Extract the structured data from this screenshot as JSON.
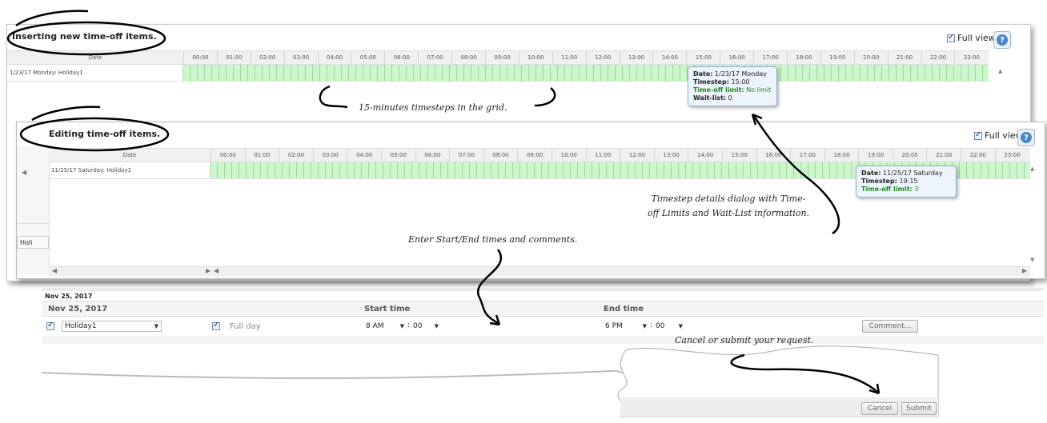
{
  "insert_panel": {
    "title": "Inserting new time-off items.",
    "full_view_label": "Full view",
    "date_header": "Date",
    "hours": [
      "00:00",
      "01:00",
      "02:00",
      "03:00",
      "04:00",
      "05:00",
      "06:00",
      "07:00",
      "08:00",
      "09:00",
      "10:00",
      "11:00",
      "12:00",
      "13:00",
      "14:00",
      "15:00",
      "16:00",
      "17:00",
      "18:00",
      "19:00",
      "20:00",
      "21:00",
      "22:00",
      "23:00"
    ],
    "row_label": "1/23/17 Monday: Holiday1",
    "tooltip": {
      "date_label": "Date:",
      "date_value": "1/23/17 Monday",
      "timestep_label": "Timestep:",
      "timestep_value": "15:00",
      "limit_label": "Time-off limit:",
      "limit_value": "No limit",
      "waitlist_label": "Wait-list:",
      "waitlist_value": "0"
    }
  },
  "edit_panel": {
    "title": "Editing time-off items.",
    "full_view_label": "Full view",
    "date_header": "Date",
    "hours": [
      "00:00",
      "01:00",
      "02:00",
      "03:00",
      "04:00",
      "05:00",
      "06:00",
      "07:00",
      "08:00",
      "09:00",
      "10:00",
      "11:00",
      "12:00",
      "13:00",
      "14:00",
      "15:00",
      "16:00",
      "17:00",
      "18:00",
      "19:00",
      "20:00",
      "21:00",
      "22:00",
      "23:00"
    ],
    "row_label": "11/25/17 Saturday: Holiday1",
    "tooltip": {
      "date_label": "Date:",
      "date_value": "11/25/17 Saturday",
      "timestep_label": "Timestep:",
      "timestep_value": "19:15",
      "limit_label": "Time-off limit:",
      "limit_value": "3"
    },
    "side_tab": "Holi"
  },
  "form": {
    "section_title": "Nov 25, 2017",
    "date_header": "Nov 25, 2017",
    "start_header": "Start time",
    "end_header": "End time",
    "type_value": "Holiday1",
    "full_day_label": "Full day",
    "start_hour": "8 AM",
    "start_min": "00",
    "end_hour": "6 PM",
    "end_min": "00",
    "time_sep": ":",
    "comment_button": "Comment..."
  },
  "buttons": {
    "cancel": "Cancel",
    "submit": "Submit"
  },
  "annotations": {
    "timesteps": "15-minutes timesteps in the grid.",
    "dialog_line1": "Timestep details dialog with Time-",
    "dialog_line2": "off Limits and Wait-List information.",
    "enter_times": "Enter Start/End times and comments.",
    "cancel_submit": "Cancel or submit your request."
  },
  "colors": {
    "grid_cell": "#ccf7cc",
    "tooltip_bg": "#eef4fc",
    "green_text": "#1c8a1c"
  }
}
